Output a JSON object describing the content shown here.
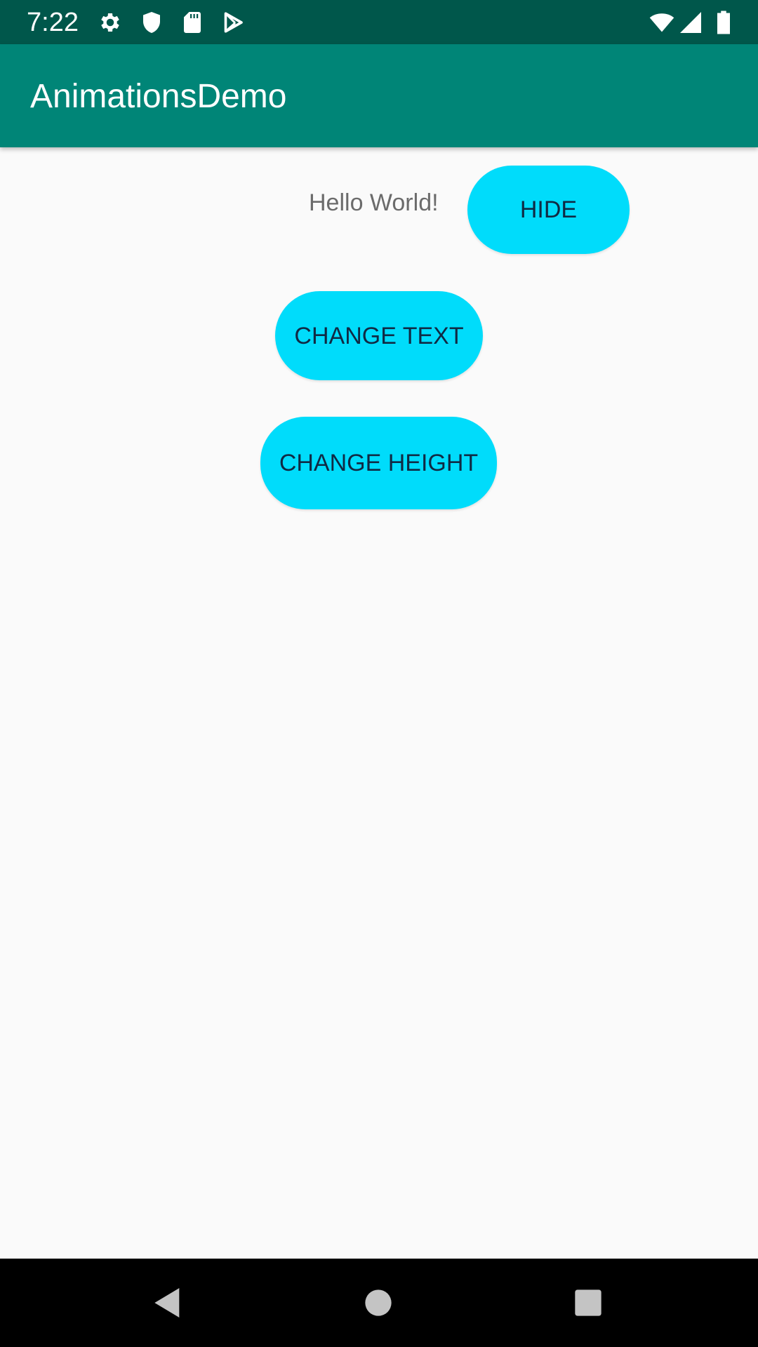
{
  "status_bar": {
    "time": "7:22",
    "left_icons": [
      "settings-icon",
      "shield-icon",
      "sd-card-icon",
      "play-store-icon"
    ],
    "right_icons": [
      "wifi-icon",
      "cellular-signal-icon",
      "battery-icon"
    ],
    "background_color": "#00574b"
  },
  "app_bar": {
    "title": "AnimationsDemo",
    "background_color": "#008577"
  },
  "content": {
    "hello_text": "Hello World!",
    "hide_button_label": "HIDE",
    "change_text_button_label": "CHANGE TEXT",
    "change_height_button_label": "CHANGE HEIGHT",
    "button_color": "#00dcfb"
  },
  "nav_bar": {
    "buttons": [
      "back-icon",
      "home-icon",
      "recents-icon"
    ]
  }
}
